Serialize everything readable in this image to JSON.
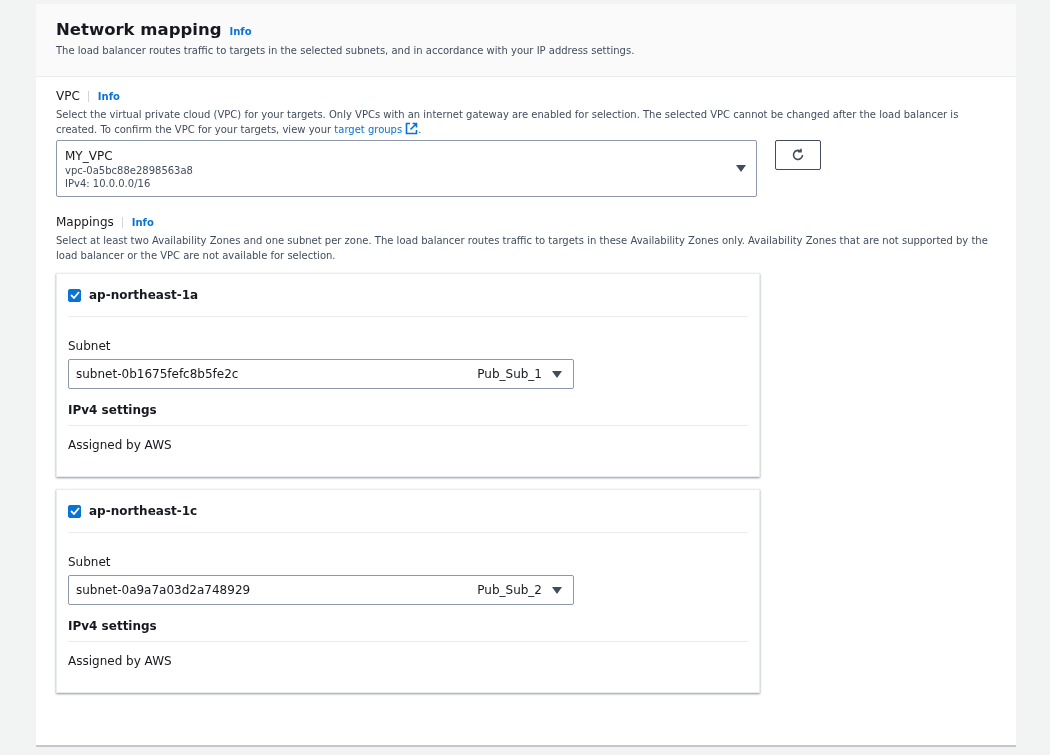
{
  "header": {
    "title": "Network mapping",
    "info": "Info",
    "description": "The load balancer routes traffic to targets in the selected subnets, and in accordance with your IP address settings."
  },
  "vpc": {
    "label": "VPC",
    "info": "Info",
    "description": "Select the virtual private cloud (VPC) for your targets. Only VPCs with an internet gateway are enabled for selection. The selected VPC cannot be changed after the load balancer is created. To confirm the VPC for your targets, view your",
    "link": "target groups",
    "description_end": ".",
    "name": "MY_VPC",
    "id": "vpc-0a5bc88e2898563a8",
    "cidr": "IPv4: 10.0.0.0/16"
  },
  "mappings": {
    "label": "Mappings",
    "info": "Info",
    "description": "Select at least two Availability Zones and one subnet per zone. The load balancer routes traffic to targets in these Availability Zones only. Availability Zones that are not supported by the load balancer or the VPC are not available for selection.",
    "zones": [
      {
        "name": "ap-northeast-1a",
        "checked": true,
        "subnet_label": "Subnet",
        "subnet_id": "subnet-0b1675fefc8b5fe2c",
        "subnet_name": "Pub_Sub_1",
        "ipv4_label": "IPv4 settings",
        "ipv4_value": "Assigned by AWS"
      },
      {
        "name": "ap-northeast-1c",
        "checked": true,
        "subnet_label": "Subnet",
        "subnet_id": "subnet-0a9a7a03d2a748929",
        "subnet_name": "Pub_Sub_2",
        "ipv4_label": "IPv4 settings",
        "ipv4_value": "Assigned by AWS"
      }
    ]
  }
}
